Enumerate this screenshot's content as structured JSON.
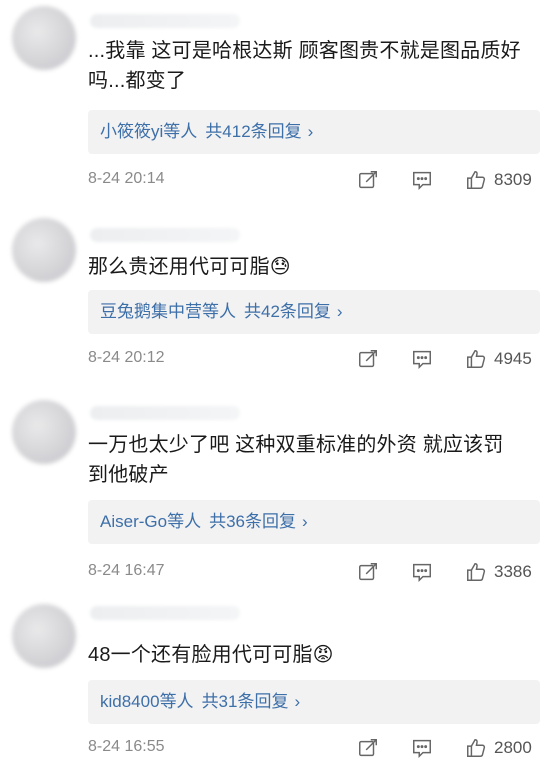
{
  "comments": [
    {
      "text_line1": "...我靠 这可是哈根达斯 顾客图贵不就是图品质好",
      "text_line2": "吗...都变了",
      "reply_who": "小筱筱yi",
      "reply_tail": "等人",
      "reply_count": "共412条回复",
      "reply_arrow": "›",
      "time": "8-24 20:14",
      "likes": "8309"
    },
    {
      "text_line1": "那么贵还用代可可脂😓",
      "text_line2": "",
      "reply_who": "豆兔鹅集中营",
      "reply_tail": "等人",
      "reply_count": "共42条回复",
      "reply_arrow": "›",
      "time": "8-24 20:12",
      "likes": "4945"
    },
    {
      "text_line1": "一万也太少了吧 这种双重标准的外资 就应该罚",
      "text_line2": "到他破产",
      "reply_who": "Aiser-Go",
      "reply_tail": "等人",
      "reply_count": "共36条回复",
      "reply_arrow": "›",
      "time": "8-24 16:47",
      "likes": "3386"
    },
    {
      "text_line1": "48一个还有脸用代可可脂😡",
      "text_line2": "",
      "reply_who": "kid8400",
      "reply_tail": "等人",
      "reply_count": "共31条回复",
      "reply_arrow": "›",
      "time": "8-24 16:55",
      "likes": "2800"
    }
  ],
  "icons": {
    "share": "share-icon",
    "comment": "comment-icon",
    "like": "thumbs-up-icon"
  },
  "colors": {
    "link": "#3d6fa8",
    "meta": "#8a8a8a",
    "reply_bg": "#f2f2f3"
  }
}
